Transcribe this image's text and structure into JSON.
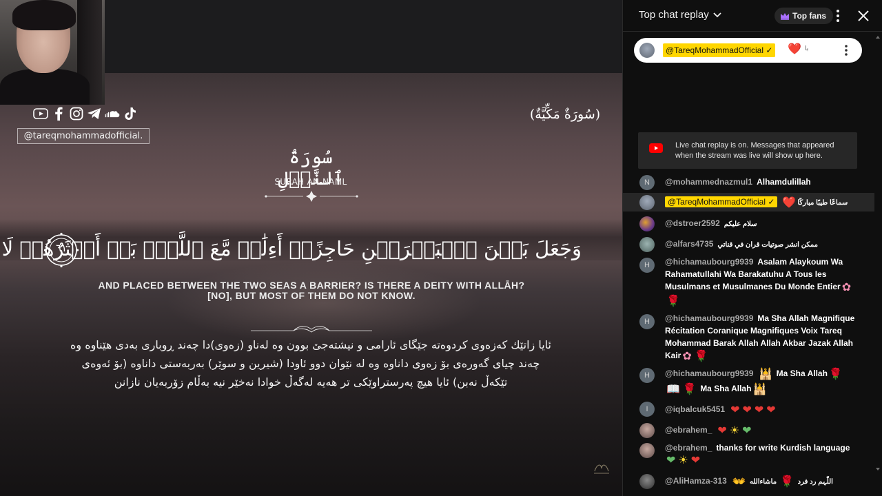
{
  "video": {
    "channel_handle": "@tareqmohammadofficial.",
    "social_icons": [
      "youtube-icon",
      "facebook-icon",
      "instagram-icon",
      "telegram-icon",
      "soundcloud-icon",
      "tiktok-icon"
    ],
    "makkiyah_label": "(سُورَةٌ مَكِّيَّةٌ)",
    "surah_name_ar": "سُورَةُ ٱلنَّمۡلِ",
    "surah_name_en": "SURAH AN-NAML",
    "ayah_number": "٦١",
    "ayah_ar": "وَجَعَلَ بَيۡنَ ٱلۡبَحۡرَيۡنِ حَاجِزًاۗ أَءِلَٰهٞ مَّعَ ٱللَّهِۚ بَلۡ أَكۡثَرُهُمۡ لَا يَعۡلَمُونَ",
    "translation_en_line1": "AND PLACED BETWEEN THE TWO SEAS A BARRIER? IS THERE A DEITY WITH ALLāH?",
    "translation_en_line2": "[NO], BUT MOST OF THEM DO NOT KNOW.",
    "translation_ku_line1": "ئایا زاتێك كەزەوی كردوەتە جێگای ئارامی و نیشتەجێ بوون وە لەناو (زەوی)دا چەند ڕوباری بەدی هێناوە وە",
    "translation_ku_line2": "چەند چیای گەورەی بۆ زەوی داناوە وە لە نێوان دوو ئاودا (شیرین و سوێر) بەربەستی داناوە (بۆ ئەوەی",
    "translation_ku_line3": "تێکەڵ نەبن) ئایا هیچ پەرستراوێکی تر هەیە لەگەڵ خوادا نەخێر نیە بەڵام زۆربەیان نازانن"
  },
  "chat": {
    "title": "Top chat replay",
    "top_fans_label": "Top fans",
    "pinned": {
      "author": "@TareqMohammadOfficial",
      "emoji": "❤️",
      "text": "با"
    },
    "notice": "Live chat replay is on. Messages that appeared when the stream was live will show up here.",
    "messages": [
      {
        "initial": "N",
        "author": "@mohammednazmul1",
        "text": "Alhamdulillah"
      },
      {
        "author": "@TareqMohammadOfficial",
        "emoji": "❤️",
        "text": "سماعًا طيبًا مباركًا"
      },
      {
        "author": "@dstroer2592",
        "text": "سلام عليكم"
      },
      {
        "author": "@alfars4735",
        "text": "ممكن انشر صوتيات قران في قناتي"
      },
      {
        "initial": "H",
        "author": "@hichamaubourg9939",
        "text": "Asalam Alaykoum Wa Rahamatullahi Wa Barakatuhu A Tous les Musulmans et Musulmanes Du Monde Entier"
      },
      {
        "initial": "H",
        "author": "@hichamaubourg9939",
        "text": "Ma Sha Allah Magnifique Récitation Coranique Magnifiques Voix Tareq Mohammad Barak Allah Allah Akbar Jazak Allah Kair"
      },
      {
        "initial": "H",
        "author": "@hichamaubourg9939",
        "text_a": "Ma Sha Allah",
        "text_b": "Ma Sha Allah"
      },
      {
        "initial": "I",
        "author": "@iqbalcuk5451"
      },
      {
        "author": "@ebrahem_"
      },
      {
        "author": "@ebrahem_",
        "text": "thanks for write Kurdish language"
      },
      {
        "author": "@AliHamza-313",
        "text_a": "اللّٰہم رد فرد",
        "text_b": "ماشاءالله"
      }
    ]
  },
  "colors": {
    "chat_bg": "#0f0f0f",
    "owner_badge": "#ffd600",
    "highlight_row": "#272727",
    "heart": "#e53935"
  }
}
